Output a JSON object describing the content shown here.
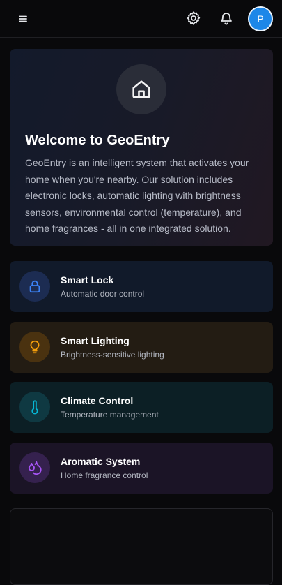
{
  "header": {
    "menu_icon": "menu-icon",
    "settings_icon": "gear-icon",
    "notifications_icon": "bell-icon",
    "avatar_initial": "P",
    "avatar_color": "#1d87e8"
  },
  "hero": {
    "icon": "home-icon",
    "title": "Welcome to GeoEntry",
    "description": "GeoEntry is an intelligent system that activates your home when you're nearby. Our solution includes electronic locks, automatic lighting with brightness sensors, environmental control (temperature), and home fragrances - all in one integrated solution."
  },
  "features": [
    {
      "icon": "lock-icon",
      "title": "Smart Lock",
      "subtitle": "Automatic door control",
      "accent": "#3b82f6"
    },
    {
      "icon": "lightbulb-icon",
      "title": "Smart Lighting",
      "subtitle": "Brightness-sensitive lighting",
      "accent": "#f59e0b"
    },
    {
      "icon": "thermometer-icon",
      "title": "Climate Control",
      "subtitle": "Temperature management",
      "accent": "#06b6d4"
    },
    {
      "icon": "droplets-icon",
      "title": "Aromatic System",
      "subtitle": "Home fragrance control",
      "accent": "#a855f7"
    }
  ]
}
